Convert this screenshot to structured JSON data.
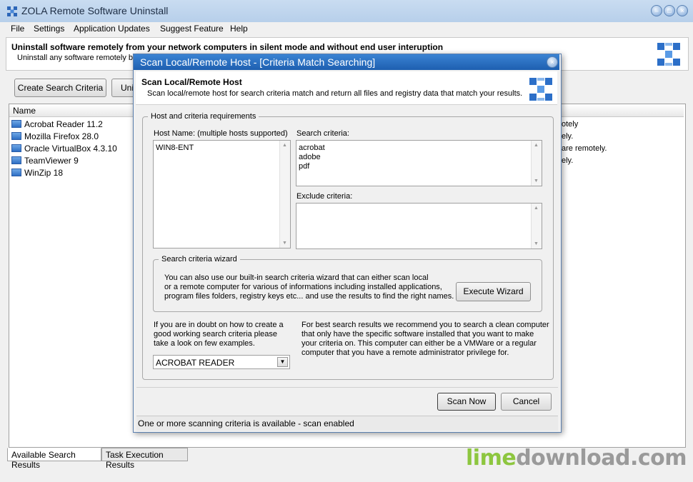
{
  "window": {
    "title": "ZOLA Remote Software Uninstall"
  },
  "menu": [
    "File",
    "Settings",
    "Application Updates",
    "Suggest Feature",
    "Help"
  ],
  "banner": {
    "title": "Uninstall software remotely from your network computers in silent mode and without end user interuption",
    "subtitle": "Uninstall any software remotely bas"
  },
  "toolbar": {
    "create_label": "Create Search Criteria",
    "uninstall_label": "Uni"
  },
  "list": {
    "header": "Name",
    "items": [
      "Acrobat Reader 11.2",
      "Mozilla Firefox 28.0",
      "Oracle VirtualBox 4.3.10",
      "TeamViewer 9",
      "WinZip 18"
    ],
    "right_texts": [
      "otely",
      "ely.",
      "are remotely.",
      "ely."
    ]
  },
  "tabs": [
    "Available Search Results",
    "Task Execution Results"
  ],
  "dialog": {
    "title": "Scan Local/Remote Host - [Criteria Match Searching]",
    "heading": "Scan Local/Remote Host",
    "description": "Scan local/remote host for search criteria match and return all files and registry data that match your results.",
    "group_label": "Host and criteria requirements",
    "host_label": "Host Name: (multiple hosts supported)",
    "host_value": "WIN8-ENT",
    "search_label": "Search criteria:",
    "search_values": [
      "acrobat",
      "adobe",
      "pdf"
    ],
    "exclude_label": "Exclude criteria:",
    "wizard_group_label": "Search criteria wizard",
    "wizard_lines": [
      "You can also use our built-in search criteria wizard that can either scan local",
      "or a remote computer for various of informations including installed applications,",
      "program files folders, registry keys etc... and use the results to find the right names."
    ],
    "wizard_button": "Execute Wizard",
    "doubt_lines": [
      "If you are in doubt on how to create a",
      "good working search criteria please",
      "take a look on few examples."
    ],
    "example_select": "ACROBAT READER",
    "tip_lines": [
      "For best search results we recommend you to search a clean computer",
      "that only have the specific software installed that you want to make",
      "your criteria on. This computer can either be a VMWare or a regular",
      "computer that you have a remote administrator privilege for."
    ],
    "scan_button": "Scan Now",
    "cancel_button": "Cancel",
    "status": "One or more scanning criteria is available - scan enabled"
  },
  "watermark": {
    "part1": "lime",
    "part2": "download.com"
  },
  "colors": {
    "title_bar": "#1e5fb0",
    "watermark_green": "#8dc63f",
    "watermark_grey": "#9a9a9a"
  },
  "icons": [
    "app-grid-icon",
    "minimize-icon",
    "maximize-icon",
    "close-icon",
    "program-icon",
    "dropdown-arrow-icon"
  ]
}
